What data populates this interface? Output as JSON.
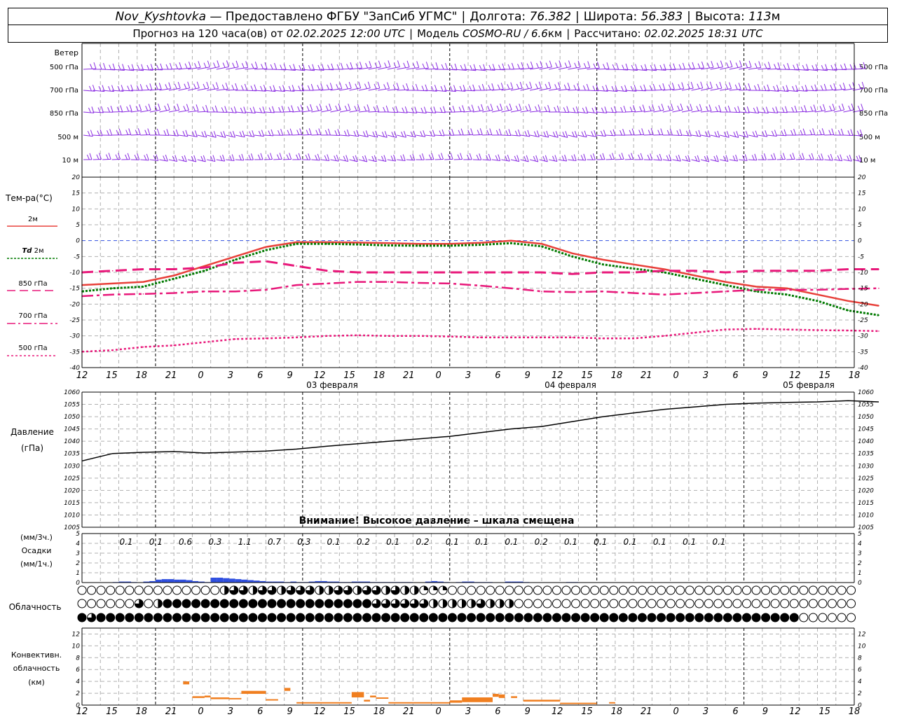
{
  "header": {
    "station": "Nov_Kyshtovka",
    "provider": "— Предоставлено ФГБУ \"ЗапСиб УГМС\"",
    "lon_label": "Долгота:",
    "lon": "76.382",
    "lat_label": "Широта:",
    "lat": "56.383",
    "alt_label": "Высота:",
    "alt": "113",
    "alt_unit": "м",
    "forecast_prefix": "Прогноз на 120 часа(ов) от",
    "forecast_from": "02.02.2025 12:00 UTC",
    "model_label": "Модель",
    "model": "COSMO-RU / 6.6",
    "model_unit": "км",
    "calc_label": "Рассчитано:",
    "calc_time": "02.02.2025 18:31 UTC"
  },
  "labels": {
    "wind": "Ветер",
    "wind_levels": [
      "500 гПа",
      "700 гПа",
      "850 гПа",
      "500 м",
      "10 м"
    ],
    "temp": "Тем-ра(°С)",
    "t2m": "2м",
    "td_prefix": "Td",
    "td_suffix": "2м",
    "t850": "850 гПа",
    "t700": "700 гПа",
    "t500": "500 гПа",
    "pressure": "Давление",
    "pressure_unit": "(гПа)",
    "warning": "Внимание! Высокое давление – шкала смещена",
    "precip_3h": "(мм/3ч.)",
    "precip": "Осадки",
    "precip_1h": "(мм/1ч.)",
    "cloud": "Облачность",
    "conv1": "Конвективн.",
    "conv2": "облачность",
    "conv3": "(км)"
  },
  "colors": {
    "wind": "#8a2be2",
    "t2m": "#e8403a",
    "td": "#007a00",
    "levels": "#e8187a",
    "pressure": "#000000",
    "precip": "#3050e0",
    "convective": "#f07f20",
    "zero_line": "#3050e0"
  },
  "chart_data": {
    "type": "line",
    "time_axis": {
      "start": "02.02.2025 12:00 UTC",
      "end": "07.02.2025 18:00 UTC",
      "hours_span": 126,
      "tick_labels": [
        "12",
        "15",
        "18",
        "21",
        "0",
        "3",
        "6",
        "9",
        "12",
        "15",
        "18",
        "21",
        "0",
        "3",
        "6",
        "9",
        "12",
        "15",
        "18",
        "21",
        "0",
        "3",
        "6",
        "9",
        "12",
        "15",
        "18"
      ],
      "day_labels": [
        "03 февраля",
        "04 февраля",
        "05 февраля"
      ]
    },
    "temperature": {
      "ylim": [
        -40,
        20
      ],
      "ticks": [
        20,
        15,
        10,
        5,
        0,
        -5,
        -10,
        -15,
        -20,
        -25,
        -30,
        -35,
        -40
      ],
      "series": [
        {
          "name": "2м",
          "values": [
            -14,
            -13.5,
            -13,
            -11,
            -8,
            -5,
            -2,
            -0.5,
            -0.5,
            -0.6,
            -0.8,
            -1,
            -1,
            -0.7,
            0,
            -1,
            -4,
            -6,
            -7.5,
            -9,
            -11,
            -13,
            -14.5,
            -15,
            -17,
            -19,
            -20.5
          ]
        },
        {
          "name": "Td 2м",
          "values": [
            -16,
            -15,
            -14.5,
            -12,
            -9.5,
            -6,
            -3,
            -1,
            -1,
            -1.2,
            -1.5,
            -1.6,
            -1.6,
            -1.3,
            -0.8,
            -1.8,
            -5,
            -7.5,
            -8.8,
            -10,
            -12,
            -14,
            -16,
            -17,
            -19,
            -22,
            -23.5
          ]
        },
        {
          "name": "850 гПа",
          "values": [
            -10,
            -9.5,
            -9,
            -9,
            -8.5,
            -7,
            -6.5,
            -8,
            -9.5,
            -10,
            -10,
            -10,
            -10,
            -10,
            -10,
            -10,
            -10.5,
            -10,
            -10,
            -9.5,
            -9.5,
            -10,
            -9.5,
            -9.5,
            -9.5,
            -9,
            -9
          ]
        },
        {
          "name": "700 гПа",
          "values": [
            -17.5,
            -17,
            -16.8,
            -16.5,
            -16,
            -16,
            -15.5,
            -14,
            -13.5,
            -13,
            -13,
            -13.3,
            -13.5,
            -14.2,
            -15,
            -16,
            -16.2,
            -16,
            -16.5,
            -17,
            -16.5,
            -16,
            -15.5,
            -15.5,
            -15.5,
            -15.2,
            -15
          ]
        },
        {
          "name": "500 гПа",
          "values": [
            -35,
            -34.5,
            -33.5,
            -33,
            -32,
            -31,
            -30.8,
            -30.5,
            -30,
            -29.8,
            -30,
            -30,
            -30.2,
            -30.5,
            -30.5,
            -30.5,
            -30.5,
            -30.8,
            -30.8,
            -30,
            -29,
            -28,
            -27.8,
            -28,
            -28.2,
            -28.3,
            -28.5
          ]
        }
      ]
    },
    "pressure": {
      "ylim": [
        1005,
        1060
      ],
      "ticks": [
        1060,
        1055,
        1050,
        1045,
        1040,
        1035,
        1030,
        1025,
        1020,
        1015,
        1010,
        1005
      ],
      "values": [
        1032,
        1035,
        1035.5,
        1035.8,
        1035.2,
        1035.6,
        1036,
        1036.8,
        1038,
        1039,
        1040,
        1041,
        1042,
        1043.5,
        1045,
        1046,
        1048,
        1050,
        1051.5,
        1053,
        1054,
        1055,
        1055.5,
        1055.8,
        1056,
        1056.5,
        1056
      ]
    },
    "precipitation": {
      "ylim": [
        0,
        5
      ],
      "ticks": [
        5,
        4,
        3,
        2,
        1,
        0
      ],
      "totals_3h": [
        "0.1",
        "0.1",
        "0.6",
        "0.3",
        "1.1",
        "0.7",
        "0.3",
        "0.1",
        "0.2",
        "0.1",
        "0.2",
        "0.1",
        "0.1",
        "0.1",
        "0.2",
        "0.1",
        "0.1",
        "0.1",
        "0.1",
        "0.1",
        "0.1"
      ],
      "hourly": [
        0,
        0,
        0,
        0,
        0,
        0.05,
        0.1,
        0.1,
        0.05,
        0,
        0.1,
        0.15,
        0.3,
        0.35,
        0.35,
        0.3,
        0.3,
        0.25,
        0.15,
        0.1,
        0.05,
        0.5,
        0.5,
        0.45,
        0.4,
        0.35,
        0.3,
        0.25,
        0.2,
        0.15,
        0.1,
        0.1,
        0.1,
        0.05,
        0.1,
        0.05,
        0.05,
        0.1,
        0.15,
        0.15,
        0.1,
        0.1,
        0.05,
        0.05,
        0.1,
        0.1,
        0.1,
        0.05,
        0.05,
        0.05,
        0.05,
        0.05,
        0.05,
        0.05,
        0,
        0,
        0.1,
        0.15,
        0.1,
        0.05,
        0,
        0.05,
        0.1,
        0.1,
        0.05,
        0.05,
        0.05,
        0,
        0,
        0.1,
        0.1,
        0.1,
        0.05,
        0,
        0,
        0,
        0,
        0,
        0,
        0.05,
        0.05,
        0,
        0,
        0,
        0,
        0,
        0,
        0,
        0,
        0,
        0,
        0,
        0,
        0,
        0,
        0,
        0,
        0,
        0,
        0,
        0,
        0,
        0,
        0,
        0,
        0,
        0,
        0,
        0,
        0,
        0,
        0,
        0,
        0,
        0,
        0,
        0,
        0,
        0,
        0,
        0,
        0,
        0,
        0,
        0,
        0
      ]
    },
    "cloud_cover": {
      "rows": [
        "high",
        "middle",
        "low"
      ],
      "values_percent": {
        "high": [
          0,
          0,
          0,
          0,
          0,
          0,
          0,
          0,
          0,
          0,
          0,
          0,
          0,
          0,
          0,
          50,
          75,
          75,
          50,
          75,
          75,
          50,
          75,
          75,
          75,
          50,
          50,
          75,
          75,
          50,
          75,
          75,
          50,
          75,
          50,
          50,
          25,
          25,
          25,
          0,
          0,
          0,
          0,
          0,
          0,
          0,
          0,
          0,
          0,
          0,
          0,
          0,
          0,
          0,
          0,
          0,
          0,
          0,
          0,
          0,
          0,
          0,
          0,
          0,
          0,
          0,
          0,
          0,
          0,
          0,
          0,
          0,
          0,
          0,
          0,
          0,
          0,
          0,
          0,
          0,
          0,
          0,
          0
        ],
        "middle": [
          0,
          0,
          0,
          0,
          0,
          0,
          75,
          0,
          50,
          100,
          100,
          100,
          100,
          100,
          100,
          100,
          100,
          100,
          100,
          100,
          100,
          100,
          100,
          100,
          100,
          100,
          100,
          100,
          100,
          100,
          100,
          75,
          75,
          75,
          75,
          75,
          75,
          50,
          50,
          50,
          50,
          50,
          75,
          50,
          50,
          50,
          0,
          0,
          0,
          0,
          0,
          0,
          0,
          0,
          0,
          0,
          0,
          0,
          0,
          0,
          0,
          0,
          0,
          0,
          0,
          0,
          0,
          0,
          0,
          0,
          0,
          0,
          0,
          0,
          0,
          0,
          0,
          0,
          0,
          0,
          0,
          0,
          0
        ],
        "low": [
          100,
          75,
          100,
          100,
          100,
          100,
          100,
          100,
          100,
          100,
          100,
          100,
          100,
          100,
          100,
          100,
          100,
          100,
          100,
          100,
          100,
          100,
          100,
          100,
          100,
          100,
          100,
          100,
          100,
          100,
          100,
          100,
          100,
          100,
          100,
          100,
          100,
          100,
          100,
          100,
          100,
          100,
          100,
          100,
          100,
          100,
          100,
          100,
          100,
          100,
          100,
          100,
          100,
          100,
          100,
          100,
          100,
          100,
          100,
          100,
          100,
          100,
          100,
          100,
          100,
          100,
          100,
          100,
          100,
          100,
          100,
          100,
          100,
          100,
          100,
          100,
          0,
          0,
          0,
          0,
          0,
          0,
          0
        ]
      }
    },
    "convective_cloud": {
      "ylim": [
        0,
        13
      ],
      "ticks": [
        12,
        10,
        8,
        6,
        4,
        2,
        0
      ],
      "segments": [
        {
          "from_h": 16.5,
          "to_h": 17.5,
          "base_km": 3.5,
          "top_km": 4.0
        },
        {
          "from_h": 18,
          "to_h": 20,
          "base_km": 1.2,
          "top_km": 1.5
        },
        {
          "from_h": 20,
          "to_h": 21,
          "base_km": 1.3,
          "top_km": 1.6
        },
        {
          "from_h": 21,
          "to_h": 24,
          "base_km": 1.0,
          "top_km": 1.3
        },
        {
          "from_h": 24,
          "to_h": 26,
          "base_km": 1.0,
          "top_km": 1.2
        },
        {
          "from_h": 26,
          "to_h": 30,
          "base_km": 1.9,
          "top_km": 2.4
        },
        {
          "from_h": 30,
          "to_h": 32,
          "base_km": 0.8,
          "top_km": 1.0
        },
        {
          "from_h": 33,
          "to_h": 34,
          "base_km": 2.4,
          "top_km": 2.9
        },
        {
          "from_h": 35,
          "to_h": 44,
          "base_km": 0.3,
          "top_km": 0.5
        },
        {
          "from_h": 44,
          "to_h": 46,
          "base_km": 1.3,
          "top_km": 2.2
        },
        {
          "from_h": 46,
          "to_h": 47,
          "base_km": 0.6,
          "top_km": 0.9
        },
        {
          "from_h": 47,
          "to_h": 48,
          "base_km": 1.3,
          "top_km": 1.6
        },
        {
          "from_h": 48,
          "to_h": 50,
          "base_km": 1.1,
          "top_km": 1.3
        },
        {
          "from_h": 50,
          "to_h": 54,
          "base_km": 0.3,
          "top_km": 0.5
        },
        {
          "from_h": 54,
          "to_h": 60,
          "base_km": 0.3,
          "top_km": 0.5
        },
        {
          "from_h": 60,
          "to_h": 62,
          "base_km": 0.4,
          "top_km": 0.8
        },
        {
          "from_h": 62,
          "to_h": 67,
          "base_km": 0.5,
          "top_km": 1.3
        },
        {
          "from_h": 67,
          "to_h": 68,
          "base_km": 1.4,
          "top_km": 1.9
        },
        {
          "from_h": 68,
          "to_h": 69,
          "base_km": 1.2,
          "top_km": 1.8
        },
        {
          "from_h": 70,
          "to_h": 71,
          "base_km": 1.2,
          "top_km": 1.5
        },
        {
          "from_h": 72,
          "to_h": 78,
          "base_km": 0.6,
          "top_km": 0.9
        },
        {
          "from_h": 78,
          "to_h": 84,
          "base_km": 0.2,
          "top_km": 0.4
        },
        {
          "from_h": 86,
          "to_h": 87,
          "base_km": 0.3,
          "top_km": 0.5
        }
      ]
    }
  }
}
